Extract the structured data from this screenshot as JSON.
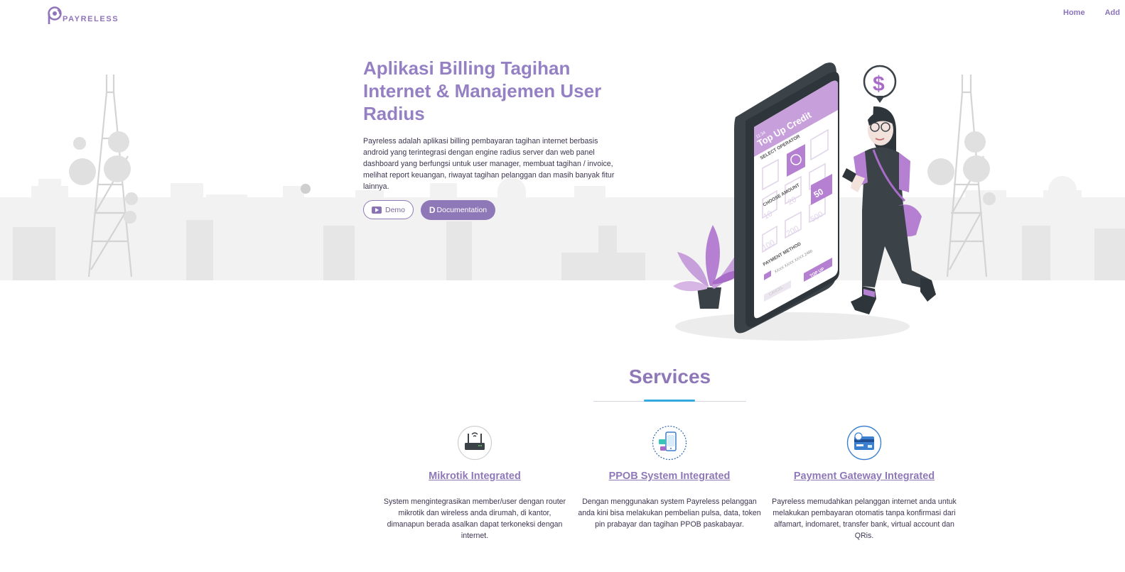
{
  "brand": {
    "name": "PAYRELESS"
  },
  "nav": {
    "items": [
      "Home",
      "Add"
    ]
  },
  "hero": {
    "title": "Aplikasi Billing Tagihan Internet & Manajemen User Radius",
    "description": "Payreless adalah aplikasi billing pembayaran tagihan internet berbasis android yang terintegrasi dengan engine radius server dan web panel dashboard yang berfungsi untuk user manager, membuat tagihan / invoice, melihat report keuangan, riwayat tagihan pelanggan dan masih banyak fitur lainnya.",
    "demo_label": "Demo",
    "docs_label": "Documentation"
  },
  "phone": {
    "title": "Top Up Credit",
    "select_operator": "SELECT OPERATOR",
    "choose_amount": "CHOOSE AMOUNT",
    "amounts": [
      "10",
      "20",
      "50",
      "100",
      "200",
      "500"
    ],
    "selected_amount": "50",
    "payment_method": "PAYMENT METHOD",
    "card_number": "XXXX XXXX XXXX 2480",
    "top_up": "TOP UP",
    "cancel": "CANCEL",
    "time": "11:34",
    "dollar": "$"
  },
  "services": {
    "heading": "Services",
    "items": [
      {
        "title": "Mikrotik Integrated",
        "description": "System mengintegrasikan member/user dengan router mikrotik dan wireless anda dirumah, di kantor, dimanapun berada asalkan dapat terkoneksi dengan internet.",
        "icon": "router-icon"
      },
      {
        "title": "PPOB System Integrated",
        "description": "Dengan menggunakan system Payreless pelanggan anda kini bisa melakukan pembelian pulsa, data, token pin prabayar dan tagihan PPOB paskabayar.",
        "icon": "mobile-payment-icon"
      },
      {
        "title": "Payment Gateway Integrated",
        "description": "Payreless memudahkan pelanggan internet anda untuk melakukan pembayaran otomatis tanpa konfirmasi dari alfamart, indomaret, transfer bank, virtual account dan QRis.",
        "icon": "payment-card-icon"
      }
    ]
  },
  "colors": {
    "primary": "#8f78b8",
    "title": "#9580c4",
    "accent": "#32a9df",
    "text": "#3d3550"
  }
}
